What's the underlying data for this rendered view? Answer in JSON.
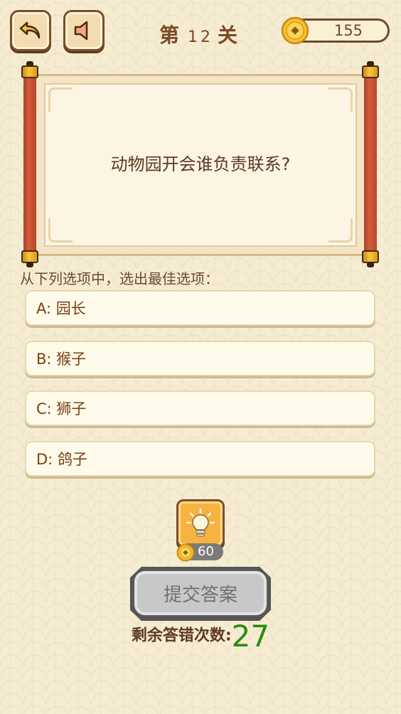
{
  "header": {
    "level_prefix": "第",
    "level_number": "12",
    "level_suffix": "关",
    "coins": "155",
    "back_icon": "back-arrow-icon",
    "sound_icon": "speaker-icon"
  },
  "question": {
    "text": "动物园开会谁负责联系?"
  },
  "instruction": "从下列选项中，选出最佳选项：",
  "options": [
    {
      "label": "A: 园长"
    },
    {
      "label": "B: 猴子"
    },
    {
      "label": "C: 狮子"
    },
    {
      "label": "D: 鸽子"
    }
  ],
  "hint": {
    "cost": "60",
    "icon": "lightbulb-icon"
  },
  "submit": {
    "label": "提交答案"
  },
  "remaining": {
    "label": "剩余答错次数:",
    "count": "27"
  },
  "colors": {
    "background": "#f6ecd2",
    "title_brown": "#7a4a25",
    "scroll_rod": "#d35a3d",
    "gold": "#f7c63b",
    "count_green": "#2b8a12",
    "submit_gray": "#c8c8c8"
  }
}
